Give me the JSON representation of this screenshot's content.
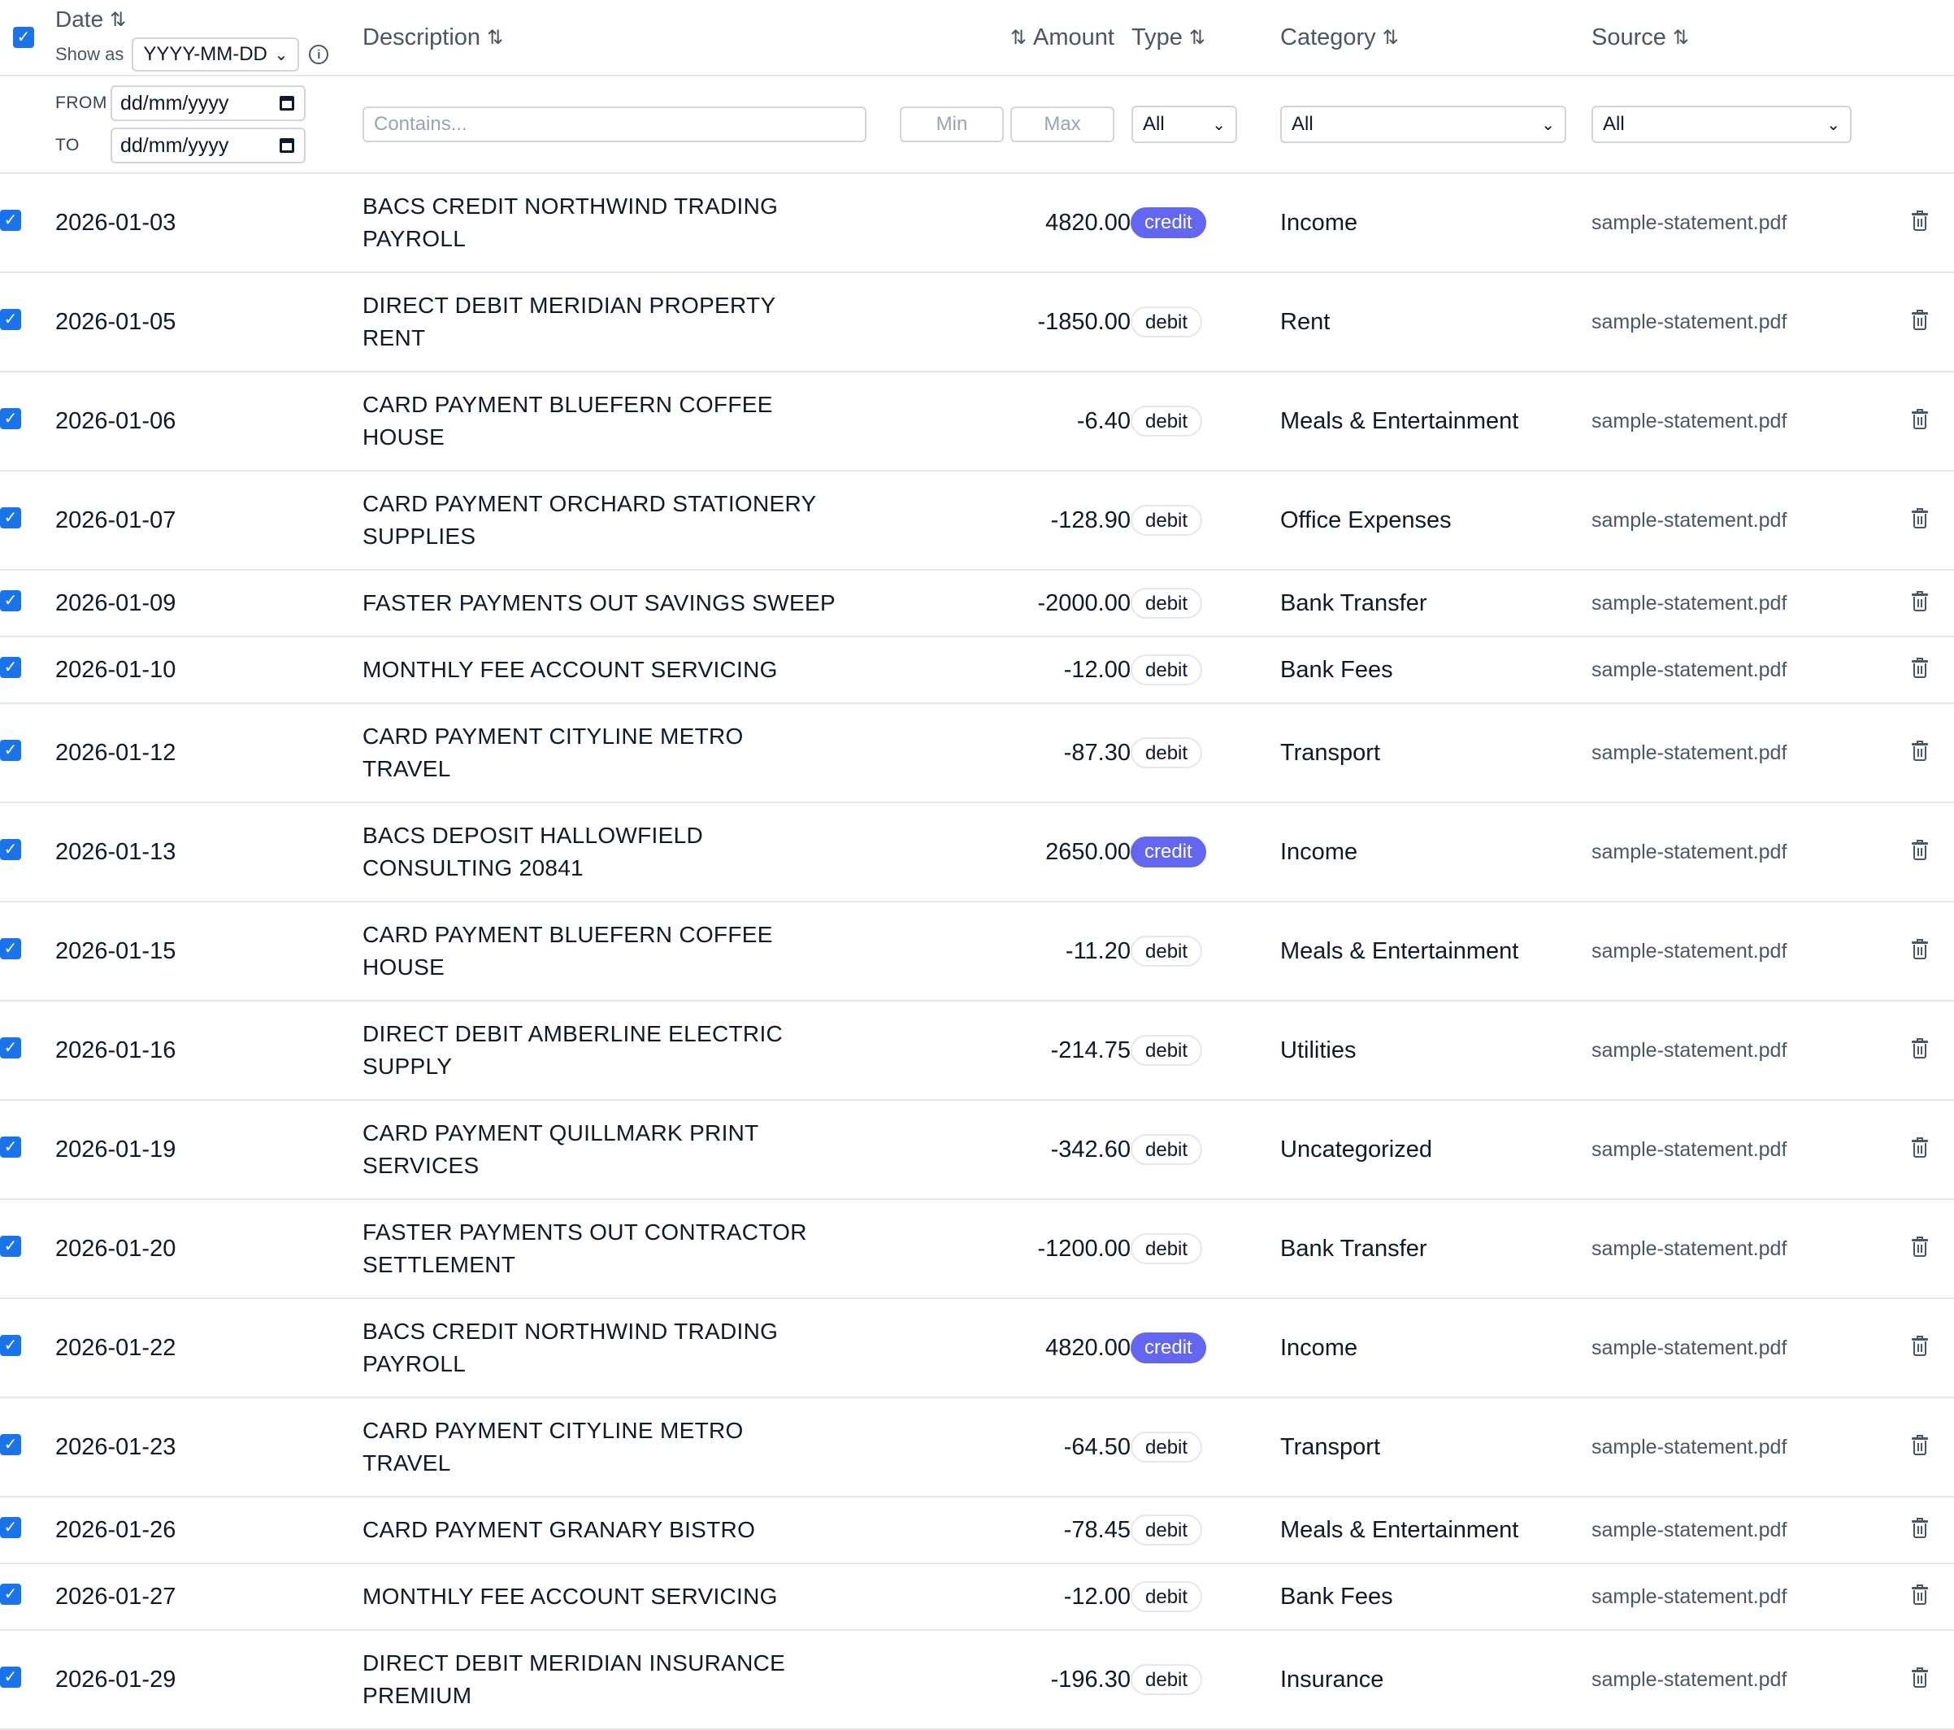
{
  "header": {
    "date_label": "Date",
    "show_as_label": "Show as",
    "date_format": "YYYY-MM-DD",
    "description_label": "Description",
    "amount_label": "Amount",
    "type_label": "Type",
    "category_label": "Category",
    "source_label": "Source",
    "sort_glyph": "⇅"
  },
  "filters": {
    "from_label": "FROM",
    "to_label": "TO",
    "from_value": "dd/mm/yyyy",
    "to_value": "dd/mm/yyyy",
    "description_placeholder": "Contains...",
    "amount_min_placeholder": "Min",
    "amount_max_placeholder": "Max",
    "type_value": "All",
    "category_value": "All",
    "source_value": "All"
  },
  "colors": {
    "checkbox": "#1a73e8",
    "credit_pill": "#6366f1",
    "border": "#e5e7eb"
  },
  "rows": [
    {
      "date": "2026-01-03",
      "desc1": "BACS CREDIT NORTHWIND TRADING",
      "desc2": "PAYROLL",
      "amount": "4820.00",
      "type": "credit",
      "category": "Income",
      "source": "sample-statement.pdf"
    },
    {
      "date": "2026-01-05",
      "desc1": "DIRECT DEBIT MERIDIAN PROPERTY",
      "desc2": "RENT",
      "amount": "-1850.00",
      "type": "debit",
      "category": "Rent",
      "source": "sample-statement.pdf"
    },
    {
      "date": "2026-01-06",
      "desc1": "CARD PAYMENT BLUEFERN COFFEE",
      "desc2": "HOUSE",
      "amount": "-6.40",
      "type": "debit",
      "category": "Meals & Entertainment",
      "source": "sample-statement.pdf"
    },
    {
      "date": "2026-01-07",
      "desc1": "CARD PAYMENT ORCHARD STATIONERY",
      "desc2": "SUPPLIES",
      "amount": "-128.90",
      "type": "debit",
      "category": "Office Expenses",
      "source": "sample-statement.pdf"
    },
    {
      "date": "2026-01-09",
      "desc1": "FASTER PAYMENTS OUT SAVINGS SWEEP",
      "desc2": "",
      "amount": "-2000.00",
      "type": "debit",
      "category": "Bank Transfer",
      "source": "sample-statement.pdf"
    },
    {
      "date": "2026-01-10",
      "desc1": "MONTHLY FEE ACCOUNT SERVICING",
      "desc2": "",
      "amount": "-12.00",
      "type": "debit",
      "category": "Bank Fees",
      "source": "sample-statement.pdf"
    },
    {
      "date": "2026-01-12",
      "desc1": "CARD PAYMENT CITYLINE METRO",
      "desc2": "TRAVEL",
      "amount": "-87.30",
      "type": "debit",
      "category": "Transport",
      "source": "sample-statement.pdf"
    },
    {
      "date": "2026-01-13",
      "desc1": "BACS DEPOSIT HALLOWFIELD",
      "desc2": "CONSULTING 20841",
      "amount": "2650.00",
      "type": "credit",
      "category": "Income",
      "source": "sample-statement.pdf"
    },
    {
      "date": "2026-01-15",
      "desc1": "CARD PAYMENT BLUEFERN COFFEE",
      "desc2": "HOUSE",
      "amount": "-11.20",
      "type": "debit",
      "category": "Meals & Entertainment",
      "source": "sample-statement.pdf"
    },
    {
      "date": "2026-01-16",
      "desc1": "DIRECT DEBIT AMBERLINE ELECTRIC",
      "desc2": "SUPPLY",
      "amount": "-214.75",
      "type": "debit",
      "category": "Utilities",
      "source": "sample-statement.pdf"
    },
    {
      "date": "2026-01-19",
      "desc1": "CARD PAYMENT QUILLMARK PRINT",
      "desc2": "SERVICES",
      "amount": "-342.60",
      "type": "debit",
      "category": "Uncategorized",
      "source": "sample-statement.pdf"
    },
    {
      "date": "2026-01-20",
      "desc1": "FASTER PAYMENTS OUT CONTRACTOR",
      "desc2": "SETTLEMENT",
      "amount": "-1200.00",
      "type": "debit",
      "category": "Bank Transfer",
      "source": "sample-statement.pdf"
    },
    {
      "date": "2026-01-22",
      "desc1": "BACS CREDIT NORTHWIND TRADING",
      "desc2": "PAYROLL",
      "amount": "4820.00",
      "type": "credit",
      "category": "Income",
      "source": "sample-statement.pdf"
    },
    {
      "date": "2026-01-23",
      "desc1": "CARD PAYMENT CITYLINE METRO",
      "desc2": "TRAVEL",
      "amount": "-64.50",
      "type": "debit",
      "category": "Transport",
      "source": "sample-statement.pdf"
    },
    {
      "date": "2026-01-26",
      "desc1": "CARD PAYMENT GRANARY BISTRO",
      "desc2": "",
      "amount": "-78.45",
      "type": "debit",
      "category": "Meals & Entertainment",
      "source": "sample-statement.pdf"
    },
    {
      "date": "2026-01-27",
      "desc1": "MONTHLY FEE ACCOUNT SERVICING",
      "desc2": "",
      "amount": "-12.00",
      "type": "debit",
      "category": "Bank Fees",
      "source": "sample-statement.pdf"
    },
    {
      "date": "2026-01-29",
      "desc1": "DIRECT DEBIT MERIDIAN INSURANCE",
      "desc2": "PREMIUM",
      "amount": "-196.30",
      "type": "debit",
      "category": "Insurance",
      "source": "sample-statement.pdf"
    }
  ]
}
